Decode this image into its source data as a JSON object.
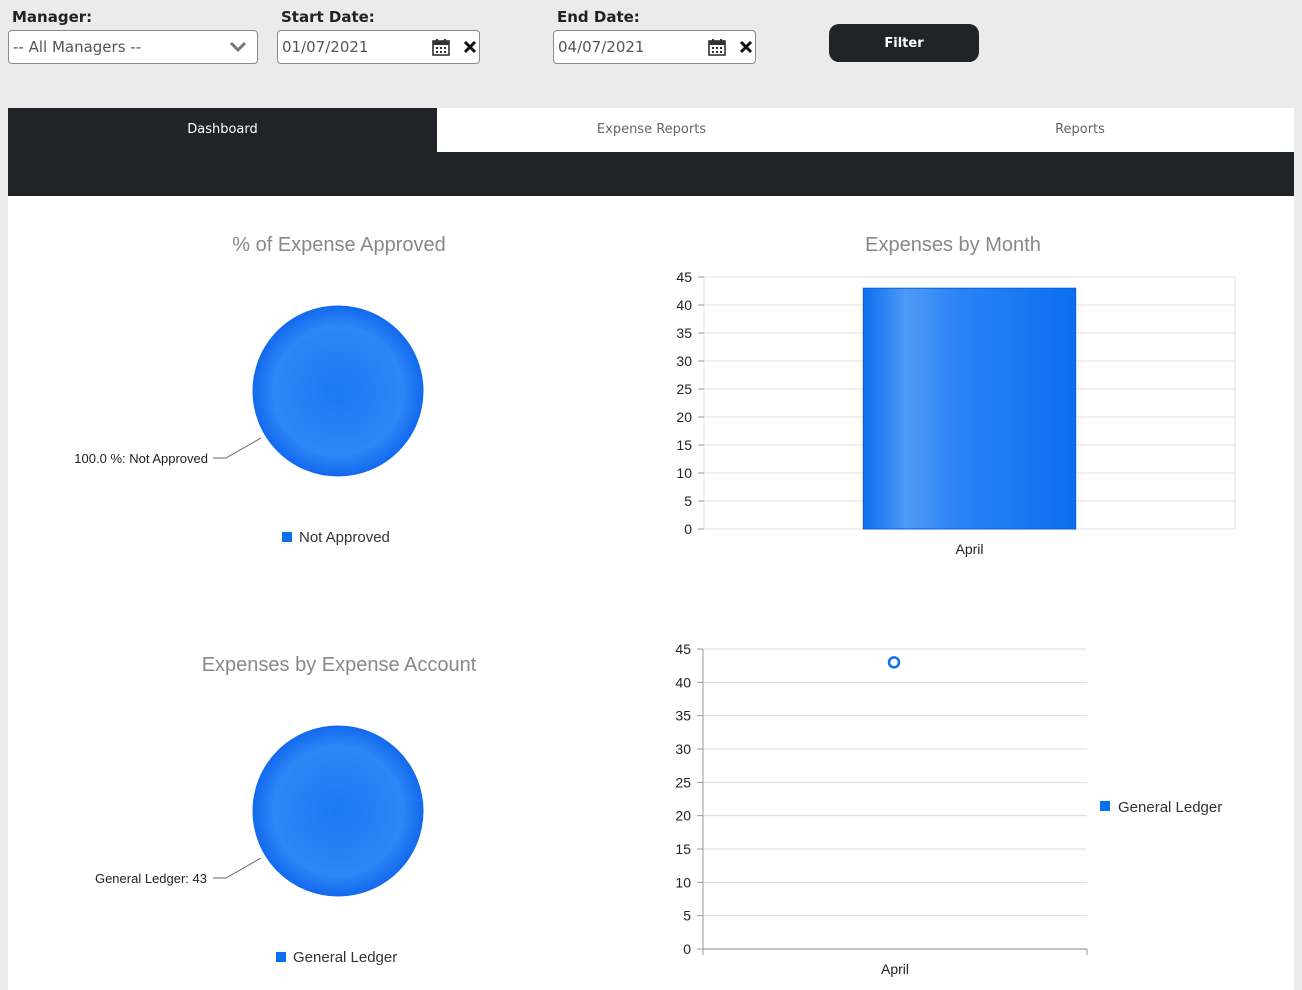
{
  "filters": {
    "manager_label": "Manager:",
    "manager_value": "-- All Managers --",
    "start_label": "Start Date:",
    "start_value": "01/07/2021",
    "end_label": "End Date:",
    "end_value": "04/07/2021",
    "filter_button": "Filter"
  },
  "tabs": [
    {
      "label": "Dashboard",
      "active": true
    },
    {
      "label": "Expense Reports",
      "active": false
    },
    {
      "label": "Reports",
      "active": false
    }
  ],
  "colors": {
    "accent": "#0a6ff0",
    "dark": "#202327"
  },
  "chart_data": [
    {
      "type": "pie",
      "title": "% of Expense Approved",
      "slices": [
        {
          "label": "Not Approved",
          "value": 100.0
        }
      ],
      "data_label": "100.0 %: Not Approved",
      "legend": [
        "Not Approved"
      ],
      "legend_position": "bottom"
    },
    {
      "type": "bar",
      "title": "Expenses by Month",
      "categories": [
        "April"
      ],
      "values": [
        43
      ],
      "ylim": [
        0,
        45
      ],
      "yticks": [
        "0",
        "5",
        "10",
        "15",
        "20",
        "25",
        "30",
        "35",
        "40",
        "45"
      ],
      "grid": true
    },
    {
      "type": "pie",
      "title": "Expenses by Expense Account",
      "slices": [
        {
          "label": "General Ledger",
          "value": 43
        }
      ],
      "data_label": "General Ledger: 43",
      "legend": [
        "General Ledger"
      ],
      "legend_position": "bottom"
    },
    {
      "type": "scatter",
      "title": "",
      "categories": [
        "April"
      ],
      "series": [
        {
          "name": "General Ledger",
          "values": [
            43
          ]
        }
      ],
      "ylim": [
        0,
        45
      ],
      "yticks": [
        "0",
        "5",
        "10",
        "15",
        "20",
        "25",
        "30",
        "35",
        "40",
        "45"
      ],
      "grid": true,
      "legend_position": "right"
    }
  ]
}
